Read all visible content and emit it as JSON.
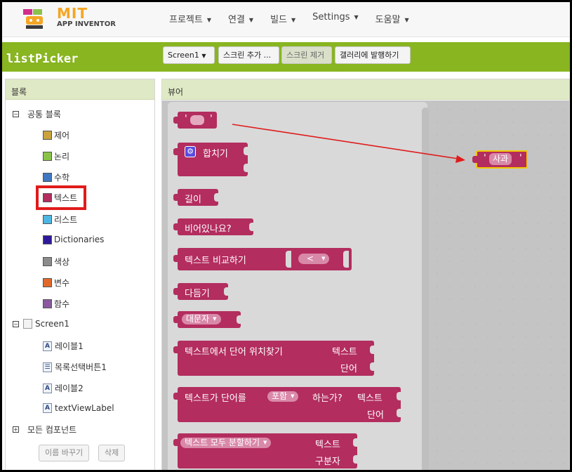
{
  "logo": {
    "mit": "MIT",
    "app_inventor": "APP INVENTOR"
  },
  "menus": [
    "프로젝트",
    "연결",
    "빌드",
    "Settings",
    "도움말"
  ],
  "project": {
    "name": "listPicker"
  },
  "toolbar": {
    "screen_select": "Screen1",
    "add_screen": "스크린 추가 ...",
    "remove_screen": "스크린 제거",
    "publish_gallery": "갤러리에 발행하기"
  },
  "blocks_panel": {
    "header": "블록",
    "builtin_label": "공통 블록",
    "builtin": [
      {
        "label": "제어",
        "color": "#c9a33d"
      },
      {
        "label": "논리",
        "color": "#8bc34a"
      },
      {
        "label": "수학",
        "color": "#3f78c1"
      },
      {
        "label": "텍스트",
        "color": "#b32d5e"
      },
      {
        "label": "리스트",
        "color": "#4db6e3"
      },
      {
        "label": "Dictionaries",
        "color": "#2d1a99"
      },
      {
        "label": "색상",
        "color": "#8c8c8c"
      },
      {
        "label": "변수",
        "color": "#e0692a"
      },
      {
        "label": "함수",
        "color": "#8b5a9e"
      }
    ],
    "screen_label": "Screen1",
    "components": [
      "레이블1",
      "목록선택버튼1",
      "레이블2",
      "textViewLabel"
    ],
    "all_components": "모든 컴포넌트",
    "rename_button": "이름 바꾸기",
    "delete_button": "삭제"
  },
  "viewer": {
    "header": "뷰어",
    "blocks": {
      "text_quote_open": "'",
      "text_quote_close": "'",
      "join": "합치기",
      "length": "길이",
      "is_empty": "비어있나요?",
      "compare": "텍스트 비교하기",
      "compare_op": "<",
      "trim": "다듬기",
      "upcase": "대문자",
      "starts_at_1": "텍스트에서 단어 위치찾기",
      "starts_at_2": "텍스트",
      "starts_at_3": "단어",
      "contains_1": "텍스트가 단어를",
      "contains_op": "포함",
      "contains_2": "하는가?",
      "contains_3": "텍스트",
      "contains_4": "단어",
      "split_op": "텍스트 모두 분할하기",
      "split_1": "텍스트",
      "split_2": "구분자"
    },
    "placed_block": {
      "quote_open": "'",
      "text": "사과",
      "quote_close": "'"
    }
  }
}
